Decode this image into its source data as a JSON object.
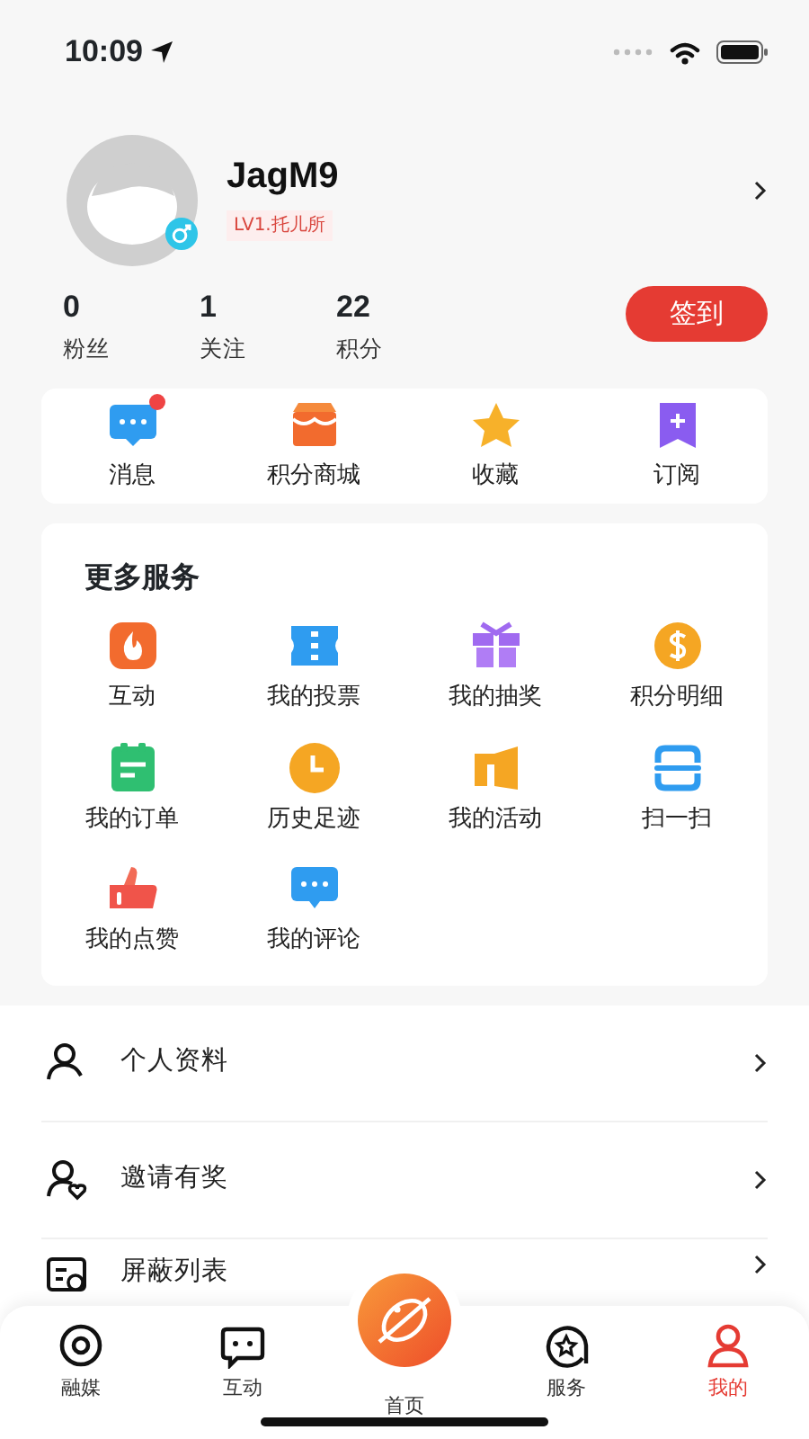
{
  "status_bar": {
    "time": "10:09"
  },
  "profile": {
    "name": "JagM9",
    "level": "LV1.托儿所"
  },
  "stats": [
    {
      "value": "0",
      "label": "粉丝"
    },
    {
      "value": "1",
      "label": "关注"
    },
    {
      "value": "22",
      "label": "积分"
    }
  ],
  "sign_in_button": "签到",
  "quick_links": [
    {
      "label": "消息",
      "unread": true
    },
    {
      "label": "积分商城",
      "unread": false
    },
    {
      "label": "收藏",
      "unread": false
    },
    {
      "label": "订阅",
      "unread": false
    }
  ],
  "more_services": {
    "title": "更多服务",
    "items": [
      "互动",
      "我的投票",
      "我的抽奖",
      "积分明细",
      "我的订单",
      "历史足迹",
      "我的活动",
      "扫一扫",
      "我的点赞",
      "我的评论"
    ]
  },
  "menu": [
    "个人资料",
    "邀请有奖",
    "屏蔽列表"
  ],
  "tab_bar": [
    {
      "label": "融媒",
      "kind": "tab",
      "selected": false
    },
    {
      "label": "互动",
      "kind": "tab",
      "selected": false
    },
    {
      "label": "首页",
      "kind": "center",
      "selected": false
    },
    {
      "label": "服务",
      "kind": "tab",
      "selected": false
    },
    {
      "label": "我的",
      "kind": "tab",
      "selected": true
    }
  ]
}
